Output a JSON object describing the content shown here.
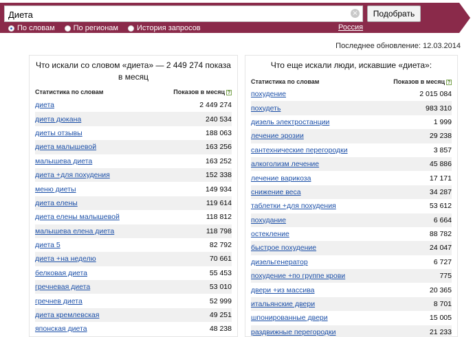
{
  "search": {
    "value": "Диета",
    "submit_label": "Подобрать",
    "modes": [
      {
        "label": "По словам",
        "checked": true
      },
      {
        "label": "По регионам",
        "checked": false
      },
      {
        "label": "История запросов",
        "checked": false
      }
    ],
    "region": "Россия"
  },
  "updated": "Последнее обновление: 12.03.2014",
  "left": {
    "title_line1": "Что искали со словом «диета» — 2 449 274 показа",
    "title_line2": "в месяц",
    "col_words": "Статистика по словам",
    "col_views": "Показов в месяц",
    "rows": [
      {
        "phrase": "диета",
        "count": "2 449 274"
      },
      {
        "phrase": "диета дюкана",
        "count": "240 534"
      },
      {
        "phrase": "диеты отзывы",
        "count": "188 063"
      },
      {
        "phrase": "диета малышевой",
        "count": "163 256"
      },
      {
        "phrase": "малышева диета",
        "count": "163 252"
      },
      {
        "phrase": "диета +для похудения",
        "count": "152 338"
      },
      {
        "phrase": "меню диеты",
        "count": "149 934"
      },
      {
        "phrase": "диета елены",
        "count": "119 614"
      },
      {
        "phrase": "диета елены малышевой",
        "count": "118 812"
      },
      {
        "phrase": "малышева елена диета",
        "count": "118 798"
      },
      {
        "phrase": "диета 5",
        "count": "82 792"
      },
      {
        "phrase": "диета +на неделю",
        "count": "70 661"
      },
      {
        "phrase": "белковая диета",
        "count": "55 453"
      },
      {
        "phrase": "гречневая диета",
        "count": "53 010"
      },
      {
        "phrase": "гречнев диета",
        "count": "52 999"
      },
      {
        "phrase": "диета кремлевская",
        "count": "49 251"
      },
      {
        "phrase": "японская диета",
        "count": "48 238"
      }
    ]
  },
  "right": {
    "title": "Что еще искали люди, искавшие «диета»:",
    "col_words": "Статистика по словам",
    "col_views": "Показов в месяц",
    "rows": [
      {
        "phrase": "похудение",
        "count": "2 015 084"
      },
      {
        "phrase": "похудеть",
        "count": "983 310"
      },
      {
        "phrase": "дизель электростанции",
        "count": "1 999"
      },
      {
        "phrase": "лечение эрозии",
        "count": "29 238"
      },
      {
        "phrase": "сантехнические перегородки",
        "count": "3 857"
      },
      {
        "phrase": "алкоголизм лечение",
        "count": "45 886"
      },
      {
        "phrase": "лечение варикоза",
        "count": "17 171"
      },
      {
        "phrase": "снижение веса",
        "count": "34 287"
      },
      {
        "phrase": "таблетки +для похудения",
        "count": "53 612"
      },
      {
        "phrase": "похудание",
        "count": "6 664"
      },
      {
        "phrase": "остекление",
        "count": "88 782"
      },
      {
        "phrase": "быстрое похудение",
        "count": "24 047"
      },
      {
        "phrase": "дизельгенератор",
        "count": "6 727"
      },
      {
        "phrase": "похудение +по группе крови",
        "count": "775"
      },
      {
        "phrase": "двери +из массива",
        "count": "20 365"
      },
      {
        "phrase": "итальянские двери",
        "count": "8 701"
      },
      {
        "phrase": "шпонированные двери",
        "count": "15 005"
      },
      {
        "phrase": "раздвижные перегородки",
        "count": "21 233"
      }
    ]
  }
}
